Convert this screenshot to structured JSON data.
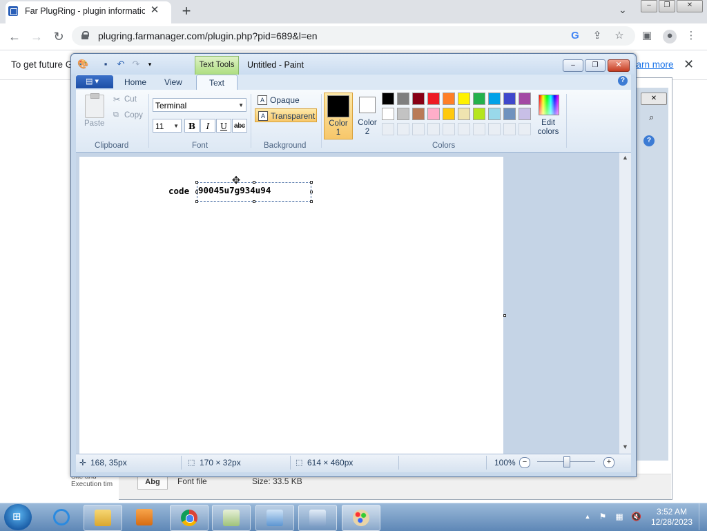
{
  "browser": {
    "tab_title": "Far PlugRing - plugin information",
    "url": "plugring.farmanager.com/plugin.php?pid=689&l=en",
    "infobar_text": "To get future G",
    "infobar_link": "earn more"
  },
  "background_window": {
    "badge": "Abg",
    "file_type": "Font file",
    "size": "Size: 33.5 KB",
    "site_text_1": "Site and",
    "site_text_2": "Execution tim"
  },
  "paint": {
    "title": "Untitled - Paint",
    "context_tab": "Text Tools",
    "tabs": [
      "Home",
      "View",
      "Text"
    ],
    "clipboard": {
      "paste": "Paste",
      "cut": "Cut",
      "copy": "Copy",
      "label": "Clipboard"
    },
    "font": {
      "family": "Terminal",
      "size": "11",
      "label": "Font",
      "bold": "B",
      "italic": "I",
      "underline": "U",
      "strike": "abc"
    },
    "background": {
      "opaque": "Opaque",
      "transparent": "Transparent",
      "label": "Background"
    },
    "colors": {
      "color1_label": "Color",
      "color1_num": "1",
      "color2_label": "Color",
      "color2_num": "2",
      "label": "Colors",
      "edit_1": "Edit",
      "edit_2": "colors",
      "color1": "#000000",
      "color2": "#ffffff",
      "row1": [
        "#000000",
        "#7f7f7f",
        "#880015",
        "#ed1c24",
        "#ff7f27",
        "#fff200",
        "#22b14c",
        "#00a2e8",
        "#3f48cc",
        "#a349a4"
      ],
      "row2": [
        "#ffffff",
        "#c3c3c3",
        "#b97a57",
        "#ffaec9",
        "#ffc90e",
        "#efe4b0",
        "#b5e61d",
        "#99d9ea",
        "#7092be",
        "#c8bfe7"
      ]
    },
    "canvas": {
      "label_text": "code :",
      "text": "90045u7g934u94"
    },
    "status": {
      "cursor": "168, 35px",
      "selection": "170 × 32px",
      "image_size": "614 × 460px",
      "zoom": "100%"
    }
  },
  "taskbar": {
    "time": "3:52 AM",
    "date": "12/28/2023"
  }
}
